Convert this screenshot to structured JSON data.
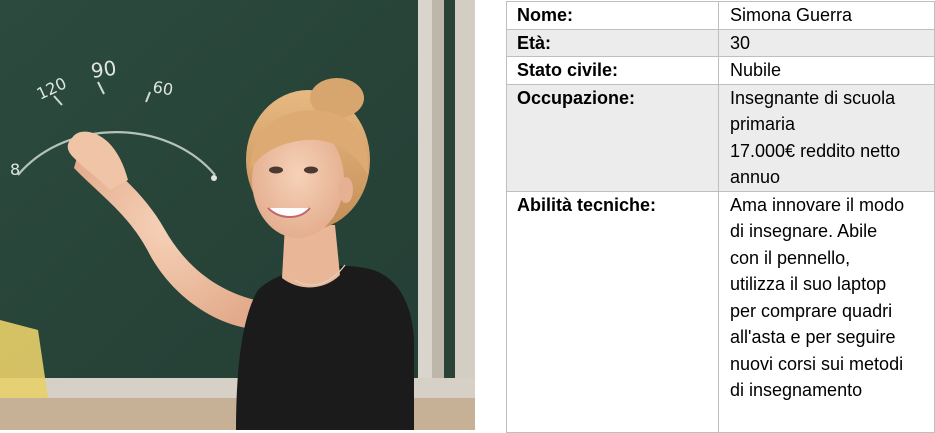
{
  "photo": {
    "subject_icon": "teacher-at-chalkboard-photo",
    "chalk_marks": [
      "90",
      "120",
      "60",
      "8"
    ],
    "colors": {
      "board": "#2d4b3f",
      "frame": "#d8d3cb",
      "wall": "#c9b59a",
      "dress": "#1a1a1a",
      "hair": "#d9a870",
      "skin": "#f1c6a9"
    }
  },
  "profile": {
    "rows": [
      {
        "label": "Nome:",
        "value_lines": [
          "Simona Guerra"
        ]
      },
      {
        "label": "Età:",
        "value_lines": [
          "30"
        ]
      },
      {
        "label": "Stato civile:",
        "value_lines": [
          "Nubile"
        ]
      },
      {
        "label": "Occupazione:",
        "value_lines": [
          "Insegnante di scuola",
          "primaria",
          "17.000€ reddito netto",
          "annuo"
        ]
      },
      {
        "label": "Abilità tecniche:",
        "value_lines": [
          "Ama innovare il modo",
          "di insegnare. Abile",
          "con il pennello,",
          "utilizza il suo laptop",
          "per comprare quadri",
          "all'asta e per seguire",
          "nuovi corsi sui metodi",
          "di insegnamento"
        ]
      }
    ]
  }
}
